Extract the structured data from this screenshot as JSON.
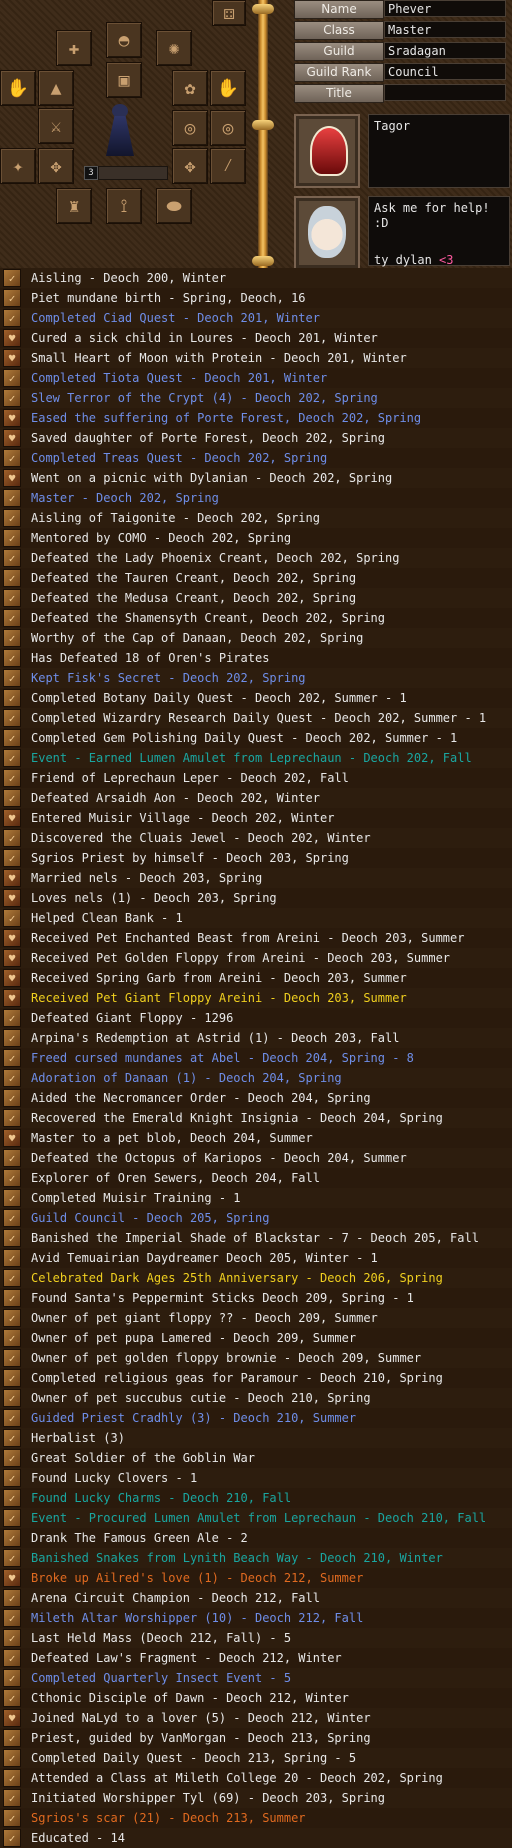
{
  "profile": {
    "fields": [
      {
        "label": "Name",
        "value": "Phever"
      },
      {
        "label": "Class",
        "value": "Master"
      },
      {
        "label": "Guild",
        "value": "Sradagan"
      },
      {
        "label": "Guild Rank",
        "value": "Council"
      },
      {
        "label": "Title",
        "value": ""
      }
    ],
    "emblem_text": "Tagor",
    "message_line1": "Ask me for help! :D",
    "message_line2": "ty dylan ",
    "message_heart": "<3",
    "slot_badge": "3"
  },
  "colors": {
    "white": "#e8e8e8",
    "blue": "#6f8ee8",
    "teal": "#1aa6a0",
    "yellow": "#f0d020",
    "orange": "#e06a20",
    "heart": "#ff5aa0"
  },
  "legend": [
    {
      "text": "Aisling - Deoch 200, Winter",
      "color": "white",
      "icon": "mark"
    },
    {
      "text": "Piet mundane birth - Spring, Deoch, 16",
      "color": "white",
      "icon": "mark"
    },
    {
      "text": "Completed Ciad Quest - Deoch 201, Winter",
      "color": "blue",
      "icon": "mark"
    },
    {
      "text": "Cured a sick child in Loures - Deoch 201, Winter",
      "color": "white",
      "icon": "heart"
    },
    {
      "text": "Small Heart of Moon with Protein - Deoch 201, Winter",
      "color": "white",
      "icon": "heart"
    },
    {
      "text": "Completed Tiota Quest - Deoch 201, Winter",
      "color": "blue",
      "icon": "mark"
    },
    {
      "text": "Slew Terror of the Crypt (4) - Deoch 202, Spring",
      "color": "blue",
      "icon": "mark"
    },
    {
      "text": "Eased the suffering of Porte Forest, Deoch 202, Spring",
      "color": "blue",
      "icon": "heart"
    },
    {
      "text": "Saved daughter of Porte Forest, Deoch 202, Spring",
      "color": "white",
      "icon": "heart"
    },
    {
      "text": "Completed Treas Quest - Deoch 202, Spring",
      "color": "blue",
      "icon": "mark"
    },
    {
      "text": "Went on a picnic with Dylanian - Deoch 202, Spring",
      "color": "white",
      "icon": "heart"
    },
    {
      "text": "Master - Deoch 202, Spring",
      "color": "blue",
      "icon": "mark"
    },
    {
      "text": "Aisling of Taigonite - Deoch 202, Spring",
      "color": "white",
      "icon": "mark"
    },
    {
      "text": "Mentored by COMO - Deoch 202, Spring",
      "color": "white",
      "icon": "mark"
    },
    {
      "text": "Defeated the Lady Phoenix Creant, Deoch 202, Spring",
      "color": "white",
      "icon": "mark"
    },
    {
      "text": "Defeated the Tauren Creant, Deoch 202, Spring",
      "color": "white",
      "icon": "mark"
    },
    {
      "text": "Defeated the Medusa Creant, Deoch 202, Spring",
      "color": "white",
      "icon": "mark"
    },
    {
      "text": "Defeated the Shamensyth Creant, Deoch 202, Spring",
      "color": "white",
      "icon": "mark"
    },
    {
      "text": "Worthy of the Cap of Danaan, Deoch 202, Spring",
      "color": "white",
      "icon": "mark"
    },
    {
      "text": "Has Defeated 18 of Oren's Pirates",
      "color": "white",
      "icon": "mark"
    },
    {
      "text": "Kept Fisk's Secret - Deoch 202, Spring",
      "color": "blue",
      "icon": "mark"
    },
    {
      "text": "Completed Botany Daily Quest - Deoch 202, Summer - 1",
      "color": "white",
      "icon": "mark"
    },
    {
      "text": "Completed Wizardry Research Daily Quest - Deoch 202, Summer - 1",
      "color": "white",
      "icon": "mark"
    },
    {
      "text": "Completed Gem Polishing Daily Quest - Deoch 202, Summer - 1",
      "color": "white",
      "icon": "mark"
    },
    {
      "text": "Event - Earned Lumen Amulet from Leprechaun - Deoch 202, Fall",
      "color": "teal",
      "icon": "mark"
    },
    {
      "text": "Friend of Leprechaun Leper - Deoch 202, Fall",
      "color": "white",
      "icon": "mark"
    },
    {
      "text": "Defeated Arsaidh Aon - Deoch 202, Winter",
      "color": "white",
      "icon": "mark"
    },
    {
      "text": "Entered Muisir Village - Deoch 202, Winter",
      "color": "white",
      "icon": "heart"
    },
    {
      "text": "Discovered the Cluais Jewel - Deoch 202, Winter",
      "color": "white",
      "icon": "mark"
    },
    {
      "text": "Sgrios Priest by himself - Deoch 203, Spring",
      "color": "white",
      "icon": "mark"
    },
    {
      "text": "Married nels - Deoch 203, Spring",
      "color": "white",
      "icon": "heart"
    },
    {
      "text": "Loves nels (1) - Deoch 203, Spring",
      "color": "white",
      "icon": "heart"
    },
    {
      "text": "Helped Clean Bank - 1",
      "color": "white",
      "icon": "mark"
    },
    {
      "text": "Received Pet Enchanted Beast from Areini - Deoch 203, Summer",
      "color": "white",
      "icon": "heart"
    },
    {
      "text": "Received Pet Golden Floppy from Areini - Deoch 203, Summer",
      "color": "white",
      "icon": "heart"
    },
    {
      "text": "Received Spring Garb from Areini - Deoch 203, Summer",
      "color": "white",
      "icon": "heart"
    },
    {
      "text": "Received Pet Giant Floppy Areini - Deoch 203, Summer",
      "color": "yellow",
      "icon": "heart"
    },
    {
      "text": "Defeated Giant Floppy - 1296",
      "color": "white",
      "icon": "mark"
    },
    {
      "text": "Arpina's Redemption at Astrid (1) - Deoch 203, Fall",
      "color": "white",
      "icon": "mark"
    },
    {
      "text": "Freed cursed mundanes at Abel - Deoch 204, Spring - 8",
      "color": "blue",
      "icon": "mark"
    },
    {
      "text": "Adoration of Danaan (1) - Deoch 204, Spring",
      "color": "blue",
      "icon": "mark"
    },
    {
      "text": "Aided the Necromancer Order - Deoch 204, Spring",
      "color": "white",
      "icon": "mark"
    },
    {
      "text": "Recovered the Emerald Knight Insignia - Deoch 204, Spring",
      "color": "white",
      "icon": "mark"
    },
    {
      "text": "Master to a pet blob, Deoch 204, Summer",
      "color": "white",
      "icon": "heart"
    },
    {
      "text": "Defeated the Octopus of Kariopos - Deoch 204, Summer",
      "color": "white",
      "icon": "mark"
    },
    {
      "text": "Explorer of Oren Sewers, Deoch 204, Fall",
      "color": "white",
      "icon": "mark"
    },
    {
      "text": "Completed Muisir Training - 1",
      "color": "white",
      "icon": "mark"
    },
    {
      "text": "Guild Council - Deoch 205, Spring",
      "color": "blue",
      "icon": "mark"
    },
    {
      "text": "Banished the Imperial Shade of Blackstar - 7 - Deoch 205, Fall",
      "color": "white",
      "icon": "mark"
    },
    {
      "text": "Avid Temuairian Daydreamer Deoch 205, Winter - 1",
      "color": "white",
      "icon": "mark"
    },
    {
      "text": "Celebrated Dark Ages 25th Anniversary - Deoch 206, Spring",
      "color": "yellow",
      "icon": "mark"
    },
    {
      "text": "Found Santa's Peppermint Sticks  Deoch 209, Spring - 1",
      "color": "white",
      "icon": "mark"
    },
    {
      "text": "Owner of pet giant floppy ?? - Deoch 209, Summer",
      "color": "white",
      "icon": "mark"
    },
    {
      "text": "Owner of pet pupa Lamered - Deoch 209, Summer",
      "color": "white",
      "icon": "mark"
    },
    {
      "text": "Owner of pet golden floppy brownie - Deoch 209, Summer",
      "color": "white",
      "icon": "mark"
    },
    {
      "text": "Completed religious geas for Paramour - Deoch 210, Spring",
      "color": "white",
      "icon": "mark"
    },
    {
      "text": "Owner of pet succubus cutie - Deoch 210, Spring",
      "color": "white",
      "icon": "mark"
    },
    {
      "text": "Guided Priest Cradhly (3) - Deoch 210, Summer",
      "color": "blue",
      "icon": "mark"
    },
    {
      "text": "Herbalist (3)",
      "color": "white",
      "icon": "mark"
    },
    {
      "text": "Great Soldier of the Goblin War",
      "color": "white",
      "icon": "mark"
    },
    {
      "text": "Found Lucky Clovers - 1",
      "color": "white",
      "icon": "mark"
    },
    {
      "text": "Found Lucky Charms - Deoch 210, Fall",
      "color": "teal",
      "icon": "mark"
    },
    {
      "text": "Event - Procured Lumen Amulet from Leprechaun - Deoch 210, Fall",
      "color": "teal",
      "icon": "mark"
    },
    {
      "text": "Drank The Famous Green Ale - 2",
      "color": "white",
      "icon": "mark"
    },
    {
      "text": "Banished Snakes from Lynith Beach Way - Deoch 210, Winter",
      "color": "teal",
      "icon": "mark"
    },
    {
      "text": "Broke up Ailred's love (1) - Deoch 212, Summer",
      "color": "orange",
      "icon": "heart"
    },
    {
      "text": "Arena Circuit Champion - Deoch 212, Fall",
      "color": "white",
      "icon": "mark"
    },
    {
      "text": "Mileth Altar Worshipper (10) - Deoch 212, Fall",
      "color": "blue",
      "icon": "mark"
    },
    {
      "text": "Last Held Mass (Deoch 212, Fall) - 5",
      "color": "white",
      "icon": "mark"
    },
    {
      "text": "Defeated Law's Fragment - Deoch 212, Winter",
      "color": "white",
      "icon": "mark"
    },
    {
      "text": "Completed Quarterly Insect Event - 5",
      "color": "blue",
      "icon": "mark"
    },
    {
      "text": "Cthonic Disciple of Dawn - Deoch 212, Winter",
      "color": "white",
      "icon": "mark"
    },
    {
      "text": "Joined NaLyd to a lover (5) - Deoch 212, Winter",
      "color": "white",
      "icon": "heart"
    },
    {
      "text": "Priest, guided by VanMorgan - Deoch 213, Spring",
      "color": "white",
      "icon": "mark"
    },
    {
      "text": "Completed Daily Quest - Deoch 213, Spring - 5",
      "color": "white",
      "icon": "mark"
    },
    {
      "text": "Attended a Class at Mileth College 20 - Deoch 202, Spring",
      "color": "white",
      "icon": "mark"
    },
    {
      "text": "Initiated Worshipper Tyl (69) - Deoch 203, Spring",
      "color": "white",
      "icon": "mark"
    },
    {
      "text": "Sgrios's scar (21) - Deoch 213, Summer",
      "color": "orange",
      "icon": "mark"
    },
    {
      "text": "Educated - 14",
      "color": "white",
      "icon": "mark"
    }
  ]
}
